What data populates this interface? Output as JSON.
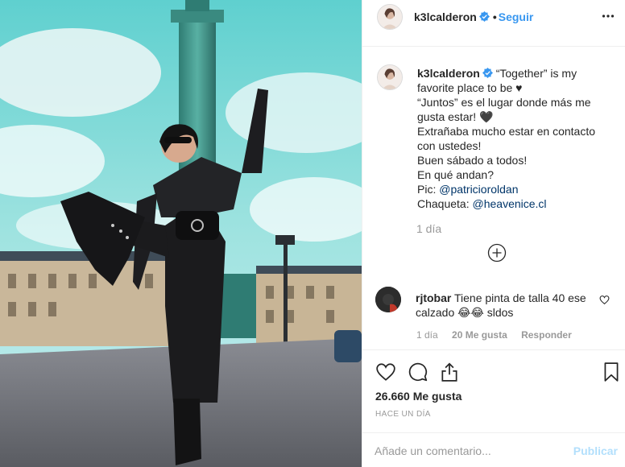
{
  "post": {
    "photo_icon": "post-photo",
    "header": {
      "username": "k3lcalderon",
      "separator": "•",
      "follow_label": "Seguir",
      "more_icon": "more-options-icon"
    },
    "caption": {
      "username": "k3lcalderon",
      "lines": [
        "“Together” is my",
        "favorite place to be ♥",
        "“Juntos” es el lugar donde más me",
        "gusta estar! 🖤",
        "Extrañaba mucho estar en contacto",
        "con ustedes!",
        "Buen sábado a todos!",
        "En qué andan?"
      ],
      "pic_label": "Pic: ",
      "pic_mention": "@patricioroldan",
      "jacket_label": "Chaqueta: ",
      "jacket_mention": "@heavenice.cl",
      "time": "1 día"
    },
    "comment": {
      "username": "rjtobar",
      "text_line1": "Tiene pinta de talla 40 ese",
      "text_line2": "calzado 😂😂 sldos",
      "time": "1 día",
      "likes": "20 Me gusta",
      "reply": "Responder"
    },
    "likes_count": "26.660 Me gusta",
    "date_label": "HACE UN DÍA",
    "add_comment_placeholder": "Añade un comentario...",
    "publish_label": "Publicar",
    "colors": {
      "link": "#3897f0",
      "mention": "#003569",
      "muted": "#999999",
      "publish_disabled": "#b2dffc"
    }
  }
}
